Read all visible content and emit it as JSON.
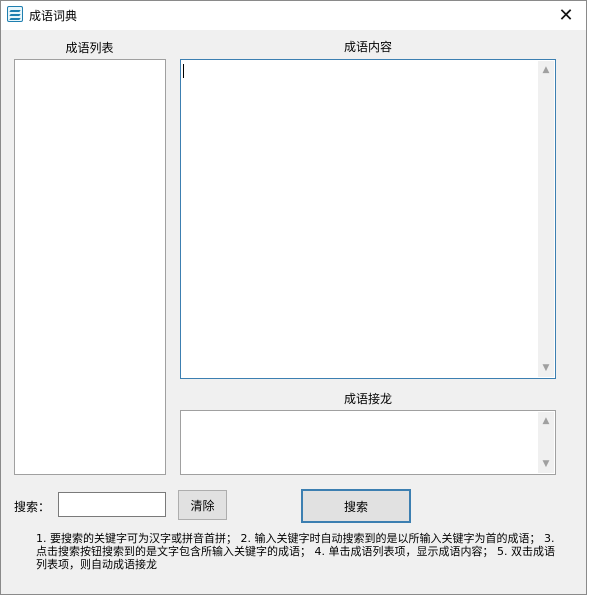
{
  "window": {
    "title": "成语词典",
    "close_icon": "close-icon"
  },
  "labels": {
    "idiom_list": "成语列表",
    "idiom_content": "成语内容",
    "idiom_chain": "成语接龙",
    "search": "搜索："
  },
  "search": {
    "value": "",
    "placeholder": ""
  },
  "buttons": {
    "clear": "清除",
    "search": "搜索"
  },
  "help_text": "1. 要搜索的关键字可为汉字或拼音首拼； 2. 输入关键字时自动搜索到的是以所输入关键字为首的成语； 3. 点击搜索按钮搜索到的是文字包含所输入关键字的成语； 4. 单击成语列表项，显示成语内容； 5. 双击成语列表项，则自动成语接龙",
  "colors": {
    "window_bg": "#f0f0f0",
    "focus_border": "#3c7fb1",
    "icon_accent": "#1f7fb0"
  }
}
